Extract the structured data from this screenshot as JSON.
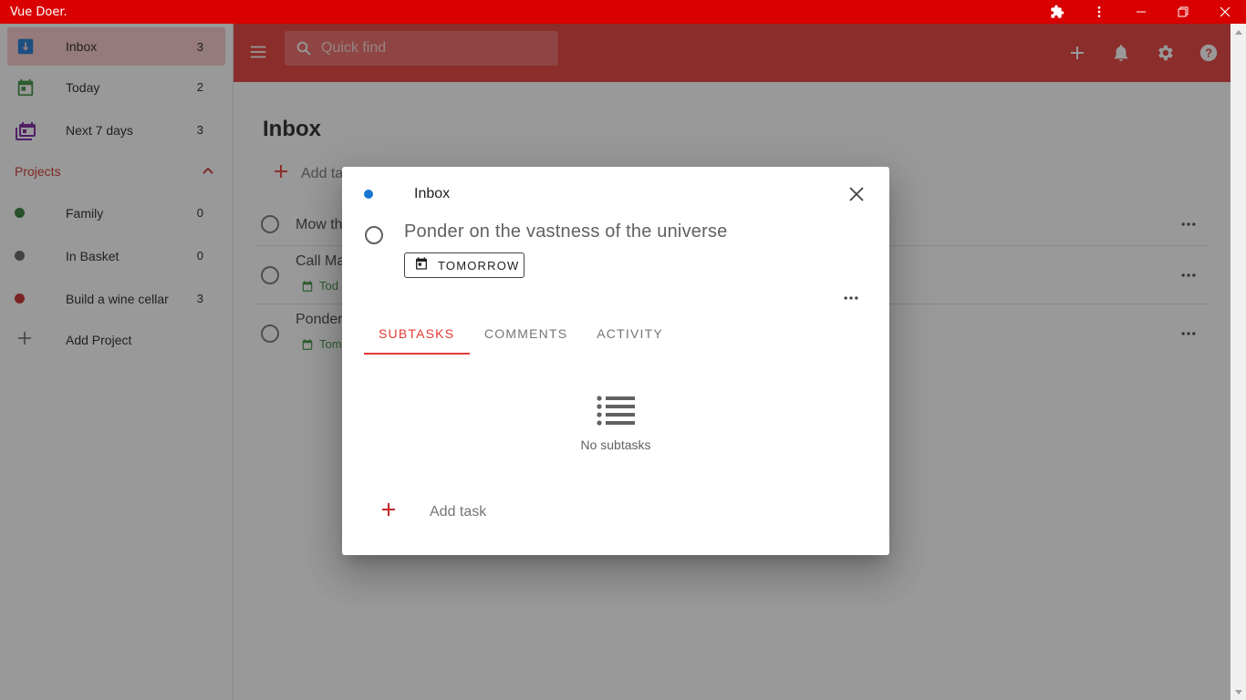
{
  "window": {
    "title": "Vue Doer."
  },
  "sidebar": {
    "items": [
      {
        "label": "Inbox",
        "count": "3",
        "icon": "inbox-icon"
      },
      {
        "label": "Today",
        "count": "2",
        "icon": "calendar-today-icon"
      },
      {
        "label": "Next 7 days",
        "count": "3",
        "icon": "calendar-range-icon"
      }
    ],
    "projects_label": "Projects",
    "projects": [
      {
        "label": "Family",
        "count": "0",
        "color": "#2e7d32"
      },
      {
        "label": "In Basket",
        "count": "0",
        "color": "#616161"
      },
      {
        "label": "Build a wine cellar",
        "count": "3",
        "color": "#c62828"
      }
    ],
    "add_project_label": "Add Project"
  },
  "search": {
    "placeholder": "Quick find"
  },
  "main": {
    "title": "Inbox",
    "add_task_label": "Add ta",
    "tasks": [
      {
        "title": "Mow th",
        "due": ""
      },
      {
        "title": "Call Ma",
        "due": "Tod"
      },
      {
        "title": "Ponder",
        "due": "Tom"
      }
    ]
  },
  "dialog": {
    "project": "Inbox",
    "project_color": "#1976d2",
    "task_title": "Ponder on the vastness of the universe",
    "due_label": "TOMORROW",
    "tabs": [
      "SUBTASKS",
      "COMMENTS",
      "ACTIVITY"
    ],
    "active_tab": "SUBTASKS",
    "empty_label": "No subtasks",
    "add_task_label": "Add task"
  },
  "colors": {
    "accent": "#e53935",
    "titlebar": "#d80000"
  }
}
